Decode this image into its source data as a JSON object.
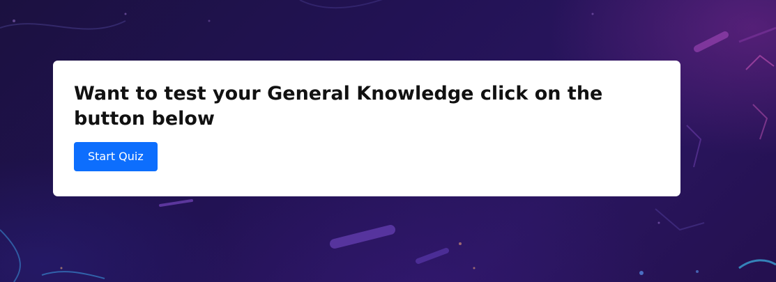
{
  "card": {
    "headline": "Want to test your General Knowledge click on the button below",
    "start_button_label": "Start Quiz"
  },
  "colors": {
    "background": "#221254",
    "card": "#ffffff",
    "button": "#0d6efd",
    "button_text": "#ffffff",
    "headline_text": "#111111"
  }
}
